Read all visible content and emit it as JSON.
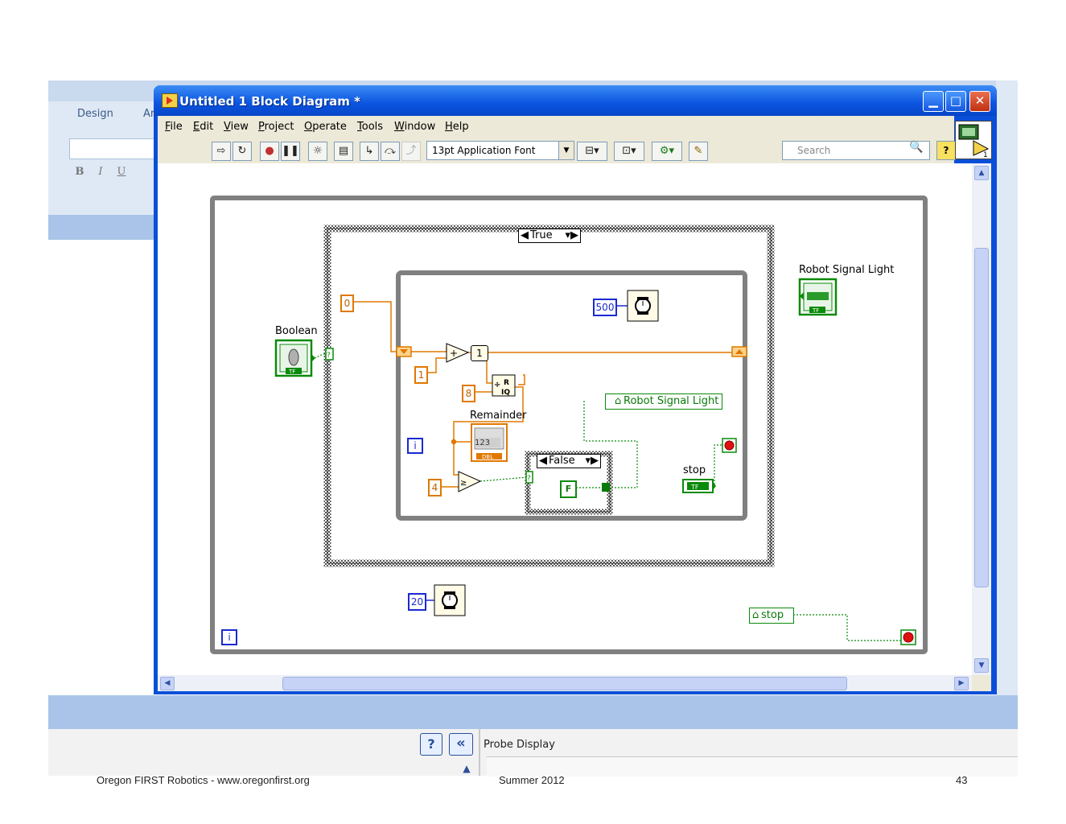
{
  "background": {
    "ribbon_tab": "Design",
    "ribbon_tab_partial": "Ar",
    "format_buttons": [
      "B",
      "I",
      "U"
    ],
    "probe_display_label": "Probe Display"
  },
  "footer": {
    "left": "Oregon FIRST Robotics - www.oregonfirst.org",
    "center": "Summer 2012",
    "page": "43"
  },
  "window": {
    "title": "Untitled 1 Block Diagram *",
    "buttons": {
      "minimize": "▁",
      "maximize": "□",
      "close": "✕"
    }
  },
  "menu": [
    "File",
    "Edit",
    "View",
    "Project",
    "Operate",
    "Tools",
    "Window",
    "Help"
  ],
  "toolbar": {
    "font": "13pt Application Font",
    "search_placeholder": "Search"
  },
  "diagram": {
    "case_outer_selector": "True",
    "case_inner_selector": "False",
    "labels": {
      "boolean": "Boolean",
      "remainder": "Remainder",
      "robot_signal_light": "Robot Signal Light",
      "stop": "stop"
    },
    "local_vars": {
      "robot_signal_light": "Robot Signal Light",
      "stop": "stop"
    },
    "constants": {
      "zero": "0",
      "one_a": "1",
      "one_b": "1",
      "eight": "8",
      "four": "4",
      "five_hundred": "500",
      "twenty": "20",
      "false_const": "F"
    },
    "indicator_text": "123",
    "loop_index": "i",
    "icon_labels": {
      "tf": "TF",
      "dbl": "DBL",
      "quotient": "R IQ"
    }
  },
  "colors": {
    "titlebar": "#0a54e0",
    "wire_integer": "#e07800",
    "wire_boolean": "#0a8a0a",
    "constant_blue": "#1a2ad0"
  }
}
